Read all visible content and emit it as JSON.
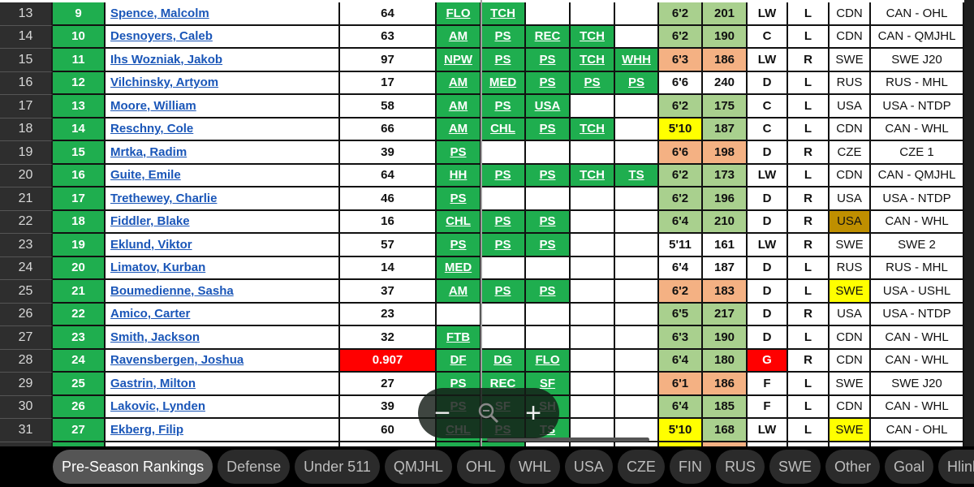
{
  "colors": {
    "tag_green": "#1fae4f",
    "height_good": "#a9d08e",
    "height_flag": "#f4b183",
    "alert_yellow": "#ffff00",
    "alert_gold": "#bf8f00",
    "alert_red": "#ff0000"
  },
  "rows": [
    {
      "row": "13",
      "rank": "9",
      "name": "Spence, Malcolm",
      "num": "64",
      "tags": [
        "FLO",
        "TCH",
        "",
        "",
        ""
      ],
      "ht": "6'2",
      "wt": "201",
      "hc": "green",
      "wc": "green",
      "pos": "LW",
      "hand": "L",
      "nat": "CDN",
      "league": "CAN - OHL"
    },
    {
      "row": "14",
      "rank": "10",
      "name": "Desnoyers, Caleb",
      "num": "63",
      "tags": [
        "AM",
        "PS",
        "REC",
        "TCH",
        ""
      ],
      "ht": "6'2",
      "wt": "190",
      "hc": "green",
      "wc": "green",
      "pos": "C",
      "hand": "L",
      "nat": "CDN",
      "league": "CAN - QMJHL"
    },
    {
      "row": "15",
      "rank": "11",
      "name": "Ihs Wozniak, Jakob",
      "num": "97",
      "tags": [
        "NPW",
        "PS",
        "PS",
        "TCH",
        "WHH"
      ],
      "ht": "6'3",
      "wt": "186",
      "hc": "salmon",
      "wc": "salmon",
      "pos": "LW",
      "hand": "R",
      "nat": "SWE",
      "league": "SWE J20"
    },
    {
      "row": "16",
      "rank": "12",
      "name": "Vilchinsky, Artyom",
      "num": "17",
      "tags": [
        "AM",
        "MED",
        "PS",
        "PS",
        "PS"
      ],
      "ht": "6'6",
      "wt": "240",
      "hc": "",
      "wc": "",
      "pos": "D",
      "hand": "L",
      "nat": "RUS",
      "league": "RUS - MHL"
    },
    {
      "row": "17",
      "rank": "13",
      "name": "Moore, William",
      "num": "58",
      "tags": [
        "AM",
        "PS",
        "USA",
        "",
        ""
      ],
      "ht": "6'2",
      "wt": "175",
      "hc": "green",
      "wc": "green",
      "pos": "C",
      "hand": "L",
      "nat": "USA",
      "league": "USA - NTDP"
    },
    {
      "row": "18",
      "rank": "14",
      "name": "Reschny, Cole",
      "num": "66",
      "tags": [
        "AM",
        "CHL",
        "PS",
        "TCH",
        ""
      ],
      "ht": "5'10",
      "wt": "187",
      "hc": "yellow",
      "wc": "green",
      "pos": "C",
      "hand": "L",
      "nat": "CDN",
      "league": "CAN - WHL"
    },
    {
      "row": "19",
      "rank": "15",
      "name": "Mrtka, Radim",
      "num": "39",
      "tags": [
        "PS",
        "",
        "",
        "",
        ""
      ],
      "ht": "6'6",
      "wt": "198",
      "hc": "salmon",
      "wc": "salmon",
      "pos": "D",
      "hand": "R",
      "nat": "CZE",
      "league": "CZE 1"
    },
    {
      "row": "20",
      "rank": "16",
      "name": "Guite, Emile",
      "num": "64",
      "tags": [
        "HH",
        "PS",
        "PS",
        "TCH",
        "TS"
      ],
      "ht": "6'2",
      "wt": "173",
      "hc": "green",
      "wc": "green",
      "pos": "LW",
      "hand": "L",
      "nat": "CDN",
      "league": "CAN - QMJHL"
    },
    {
      "row": "21",
      "rank": "17",
      "name": "Trethewey, Charlie",
      "num": "46",
      "tags": [
        "PS",
        "",
        "",
        "",
        ""
      ],
      "ht": "6'2",
      "wt": "196",
      "hc": "green",
      "wc": "green",
      "pos": "D",
      "hand": "R",
      "nat": "USA",
      "league": "USA - NTDP"
    },
    {
      "row": "22",
      "rank": "18",
      "name": "Fiddler, Blake",
      "num": "16",
      "tags": [
        "CHL",
        "PS",
        "PS",
        "",
        ""
      ],
      "ht": "6'4",
      "wt": "210",
      "hc": "green",
      "wc": "green",
      "pos": "D",
      "hand": "R",
      "nat": "USA",
      "natc": "gold",
      "league": "CAN - WHL"
    },
    {
      "row": "23",
      "rank": "19",
      "name": "Eklund, Viktor",
      "num": "57",
      "tags": [
        "PS",
        "PS",
        "PS",
        "",
        ""
      ],
      "ht": "5'11",
      "wt": "161",
      "hc": "",
      "wc": "",
      "pos": "LW",
      "hand": "R",
      "nat": "SWE",
      "league": "SWE 2"
    },
    {
      "row": "24",
      "rank": "20",
      "name": "Limatov, Kurban",
      "num": "14",
      "tags": [
        "MED",
        "",
        "",
        "",
        ""
      ],
      "ht": "6'4",
      "wt": "187",
      "hc": "",
      "wc": "",
      "pos": "D",
      "hand": "L",
      "nat": "RUS",
      "league": "RUS - MHL"
    },
    {
      "row": "25",
      "rank": "21",
      "name": "Boumedienne, Sasha",
      "num": "37",
      "tags": [
        "AM",
        "PS",
        "PS",
        "",
        ""
      ],
      "ht": "6'2",
      "wt": "183",
      "hc": "salmon",
      "wc": "salmon",
      "pos": "D",
      "hand": "L",
      "nat": "SWE",
      "natc": "yellow",
      "league": "USA - USHL"
    },
    {
      "row": "26",
      "rank": "22",
      "name": "Amico, Carter",
      "num": "23",
      "tags": [
        "",
        "",
        "",
        "",
        ""
      ],
      "ht": "6'5",
      "wt": "217",
      "hc": "green",
      "wc": "green",
      "pos": "D",
      "hand": "R",
      "nat": "USA",
      "league": "USA - NTDP"
    },
    {
      "row": "27",
      "rank": "23",
      "name": "Smith, Jackson",
      "num": "32",
      "tags": [
        "FTB",
        "",
        "",
        "",
        ""
      ],
      "ht": "6'3",
      "wt": "190",
      "hc": "green",
      "wc": "green",
      "pos": "D",
      "hand": "L",
      "nat": "CDN",
      "league": "CAN - WHL"
    },
    {
      "row": "28",
      "rank": "24",
      "name": "Ravensbergen, Joshua",
      "num": "0.907",
      "numc": "red",
      "tags": [
        "DF",
        "DG",
        "FLO",
        "",
        ""
      ],
      "ht": "6'4",
      "wt": "180",
      "hc": "green",
      "wc": "green",
      "pos": "G",
      "posc": "red",
      "hand": "R",
      "nat": "CDN",
      "league": "CAN - WHL"
    },
    {
      "row": "29",
      "rank": "25",
      "name": "Gastrin, Milton",
      "num": "27",
      "tags": [
        "PS",
        "REC",
        "SF",
        "",
        ""
      ],
      "ht": "6'1",
      "wt": "186",
      "hc": "salmon",
      "wc": "salmon",
      "pos": "F",
      "hand": "L",
      "nat": "SWE",
      "league": "SWE J20"
    },
    {
      "row": "30",
      "rank": "26",
      "name": "Lakovic, Lynden",
      "num": "39",
      "tags": [
        "PS",
        "SF",
        "SH",
        "",
        ""
      ],
      "ht": "6'4",
      "wt": "185",
      "hc": "green",
      "wc": "green",
      "pos": "F",
      "hand": "L",
      "nat": "CDN",
      "league": "CAN - WHL"
    },
    {
      "row": "31",
      "rank": "27",
      "name": "Ekberg, Filip",
      "num": "60",
      "tags": [
        "CHL",
        "PS",
        "TS",
        "",
        ""
      ],
      "ht": "5'10",
      "wt": "168",
      "hc": "yellow",
      "wc": "green",
      "pos": "LW",
      "hand": "L",
      "nat": "SWE",
      "natc": "yellow",
      "league": "CAN - OHL"
    }
  ],
  "zoom_control": {
    "zoom_out": "−",
    "zoom_in": "+",
    "icon": "zoom-out-magnifier-icon"
  },
  "tabs": [
    {
      "label": "Pre-Season Rankings",
      "active": true
    },
    {
      "label": "Defense"
    },
    {
      "label": "Under 511"
    },
    {
      "label": "QMJHL"
    },
    {
      "label": "OHL"
    },
    {
      "label": "WHL"
    },
    {
      "label": "USA"
    },
    {
      "label": "CZE"
    },
    {
      "label": "FIN"
    },
    {
      "label": "RUS"
    },
    {
      "label": "SWE"
    },
    {
      "label": "Other"
    },
    {
      "label": "Goal"
    },
    {
      "label": "Hlinka"
    }
  ]
}
